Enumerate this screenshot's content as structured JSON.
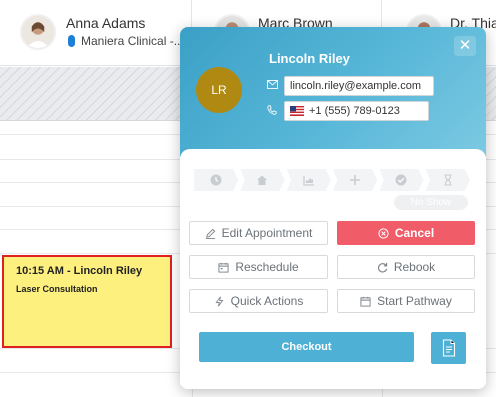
{
  "staff": [
    {
      "name": "Anna Adams",
      "subtitle": "Maniera Clinical -..."
    },
    {
      "name": "Marc Brown"
    },
    {
      "name": "Dr. Thiag"
    }
  ],
  "appointment": {
    "time_client": "10:15 AM - Lincoln Riley",
    "service": "Laser Consultation"
  },
  "popover": {
    "close_glyph": "✕",
    "initials": "LR",
    "client_name": "Lincoln Riley",
    "email": "lincoln.riley@example.com",
    "phone": "+1 (555) 789-0123",
    "status_steps": [
      "clock-icon",
      "home-icon",
      "arrival-icon",
      "plus-icon",
      "check-circle-icon",
      "hourglass-icon"
    ],
    "no_show_label": "No Show",
    "buttons": {
      "edit": "Edit Appointment",
      "cancel": "Cancel",
      "reschedule": "Reschedule",
      "rebook": "Rebook",
      "quick_actions": "Quick Actions",
      "start_pathway": "Start Pathway",
      "checkout": "Checkout"
    }
  },
  "colors": {
    "header_gradient_start": "#3ba0c6",
    "header_gradient_end": "#7cc9e2",
    "avatar_bg": "#b08912",
    "cancel": "#f15c69",
    "checkout": "#4fb0d6",
    "appointment_bg": "#fdf07f",
    "appointment_border": "#e02020",
    "staff_pill": "#1e7fd6"
  }
}
